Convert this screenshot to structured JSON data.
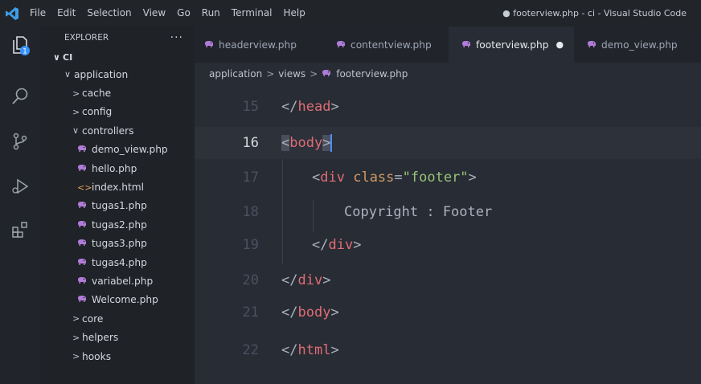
{
  "menu": [
    "File",
    "Edit",
    "Selection",
    "View",
    "Go",
    "Run",
    "Terminal",
    "Help"
  ],
  "window_title": "● footerview.php - ci - Visual Studio Code",
  "activity": {
    "badge": "1"
  },
  "explorer": {
    "header": "EXPLORER",
    "more": "···",
    "root": "CI",
    "items": [
      {
        "label": "application",
        "chevron": "∨",
        "icon": "none"
      },
      {
        "label": "cache",
        "chevron": ">",
        "icon": "none"
      },
      {
        "label": "config",
        "chevron": ">",
        "icon": "none"
      },
      {
        "label": "controllers",
        "chevron": "∨",
        "icon": "none"
      },
      {
        "label": "demo_view.php",
        "chevron": "",
        "icon": "php-icon"
      },
      {
        "label": "hello.php",
        "chevron": "",
        "icon": "php-icon"
      },
      {
        "label": "index.html",
        "chevron": "",
        "icon": "html-icon"
      },
      {
        "label": "tugas1.php",
        "chevron": "",
        "icon": "php-icon"
      },
      {
        "label": "tugas2.php",
        "chevron": "",
        "icon": "php-icon"
      },
      {
        "label": "tugas3.php",
        "chevron": "",
        "icon": "php-icon"
      },
      {
        "label": "tugas4.php",
        "chevron": "",
        "icon": "php-icon"
      },
      {
        "label": "variabel.php",
        "chevron": "",
        "icon": "php-icon"
      },
      {
        "label": "Welcome.php",
        "chevron": "",
        "icon": "php-icon"
      },
      {
        "label": "core",
        "chevron": ">",
        "icon": "none"
      },
      {
        "label": "helpers",
        "chevron": ">",
        "icon": "none"
      },
      {
        "label": "hooks",
        "chevron": ">",
        "icon": "none"
      }
    ]
  },
  "tabs": [
    {
      "label": "headerview.php",
      "active": false
    },
    {
      "label": "contentview.php",
      "active": false
    },
    {
      "label": "footerview.php",
      "active": true,
      "dirty": "●"
    },
    {
      "label": "demo_view.php",
      "active": false
    }
  ],
  "breadcrumb": {
    "part1": "application",
    "part2": "views",
    "part3": "footerview.php",
    "sep": ">"
  },
  "editor": {
    "lines": [
      {
        "num": "15",
        "code": "</head>"
      },
      {
        "num": "16",
        "code": "<body>"
      },
      {
        "num": "17",
        "code": "<div class=\"footer\">"
      },
      {
        "num": "18",
        "code": "Copyright : Footer"
      },
      {
        "num": "19",
        "code": "</div>"
      },
      {
        "num": "20",
        "code": "</div>"
      },
      {
        "num": "21",
        "code": "</body>"
      },
      {
        "num": "22",
        "code": "</html>"
      }
    ],
    "tokens": {
      "lt": "<",
      "lts": "</",
      "gt": ">",
      "head": "head",
      "body": "body",
      "div": "div",
      "html": "html",
      "class_attr": "class",
      "eq": "=",
      "footer_str": "\"footer\"",
      "copyright": "Copyright : Footer"
    }
  },
  "colors": {
    "accent": "#528bff",
    "tag": "#e06c75",
    "string": "#98c379",
    "attr": "#d19a66",
    "badge": "#3794ff"
  }
}
